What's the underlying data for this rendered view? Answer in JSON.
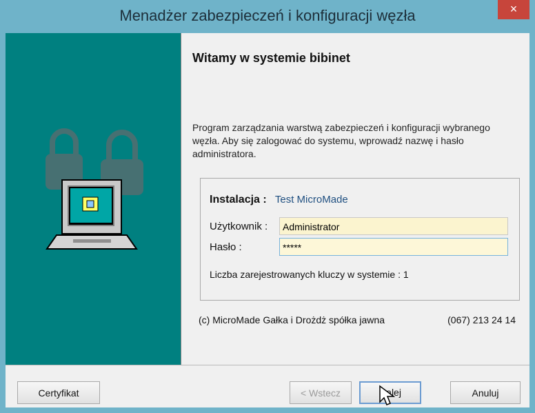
{
  "window": {
    "title": "Menadżer zabezpieczeń i konfiguracji węzła",
    "close_label": "×"
  },
  "welcome": {
    "heading": "Witamy w systemie bibinet",
    "description": "Program zarządzania warstwą zabezpieczeń i konfiguracji wybranego węzła. Aby się zalogować do systemu, wprowadź nazwę i hasło administratora."
  },
  "login": {
    "installation_label": "Instalacja :",
    "installation_value": "Test MicroMade",
    "user_label": "Użytkownik :",
    "user_value": "Administrator",
    "password_label": "Hasło :",
    "password_value": "*****",
    "keys_text": "Liczba zarejestrowanych kluczy w systemie : 1"
  },
  "footer": {
    "copyright": "(c) MicroMade Gałka i Drożdż spółka jawna",
    "phone": "(067) 213 24 14"
  },
  "buttons": {
    "certificate": "Certyfikat",
    "back": "< Wstecz",
    "next": "Dalej",
    "cancel": "Anuluj"
  }
}
